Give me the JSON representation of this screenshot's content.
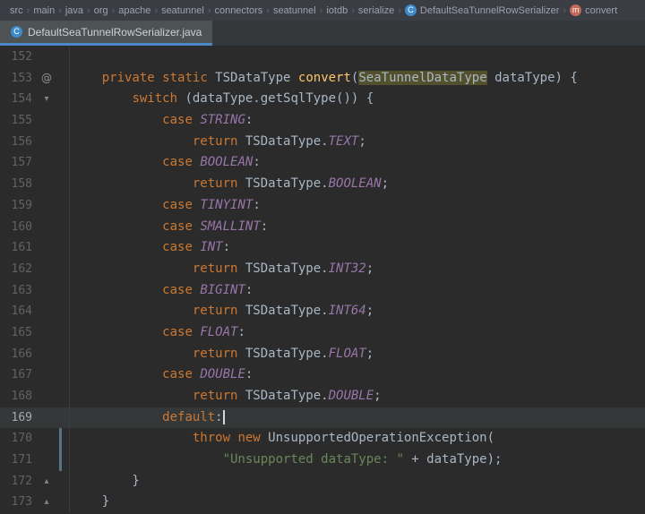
{
  "colors": {
    "editor_bg": "#2b2b2b",
    "navbar_bg": "#3a3d44",
    "tabbar_bg": "#35383a",
    "tab_bg": "#4d5355",
    "tab_underline": "#4a88c7",
    "caret_line_bg": "#343839",
    "gutter_text": "#606366",
    "keyword": "#cc7832",
    "plain": "#a9b7c6",
    "method_decl": "#ffc66b",
    "constant": "#9876aa",
    "string": "#6a8759",
    "identifier_highlight_bg": "#53502d",
    "vcs_changed": "#557387",
    "class_icon_bg": "#3f8ccb",
    "method_icon_bg": "#c4685a"
  },
  "icons": {
    "at": "@",
    "chevron_down": "▾",
    "chevron_up": "▴",
    "class_letter": "C",
    "method_letter": "m",
    "separator": "›"
  },
  "navbar": {
    "items": [
      {
        "label": "src"
      },
      {
        "label": "main"
      },
      {
        "label": "java"
      },
      {
        "label": "org"
      },
      {
        "label": "apache"
      },
      {
        "label": "seatunnel"
      },
      {
        "label": "connectors"
      },
      {
        "label": "seatunnel"
      },
      {
        "label": "iotdb"
      },
      {
        "label": "serialize"
      },
      {
        "label": "DefaultSeaTunnelRowSerializer",
        "icon": "class"
      },
      {
        "label": "convert",
        "icon": "method"
      }
    ]
  },
  "tabbar": {
    "tabs": [
      {
        "label": "DefaultSeaTunnelRowSerializer.java",
        "icon": "class",
        "active": true
      }
    ]
  },
  "editor": {
    "caret_line": "169",
    "lines": [
      {
        "num": "152",
        "tokens": []
      },
      {
        "num": "153",
        "gutter_icon": "at",
        "tokens": [
          [
            "pl",
            "    "
          ],
          [
            "kw",
            "private"
          ],
          [
            "pl",
            " "
          ],
          [
            "kw",
            "static"
          ],
          [
            "pl",
            " TSDataType "
          ],
          [
            "fn",
            "convert"
          ],
          [
            "pl",
            "("
          ],
          [
            "hl",
            "SeaTunnelDataType"
          ],
          [
            "pl",
            " dataType) {"
          ]
        ]
      },
      {
        "num": "154",
        "gutter_icon": "chevron_down",
        "tokens": [
          [
            "pl",
            "        "
          ],
          [
            "kw",
            "switch"
          ],
          [
            "pl",
            " (dataType.getSqlType()) {"
          ]
        ]
      },
      {
        "num": "155",
        "tokens": [
          [
            "pl",
            "            "
          ],
          [
            "kw",
            "case"
          ],
          [
            "pl",
            " "
          ],
          [
            "cn",
            "STRING"
          ],
          [
            "pl",
            ":"
          ]
        ]
      },
      {
        "num": "156",
        "tokens": [
          [
            "pl",
            "                "
          ],
          [
            "kw",
            "return"
          ],
          [
            "pl",
            " TSDataType."
          ],
          [
            "cn",
            "TEXT"
          ],
          [
            "pl",
            ";"
          ]
        ]
      },
      {
        "num": "157",
        "tokens": [
          [
            "pl",
            "            "
          ],
          [
            "kw",
            "case"
          ],
          [
            "pl",
            " "
          ],
          [
            "cn",
            "BOOLEAN"
          ],
          [
            "pl",
            ":"
          ]
        ]
      },
      {
        "num": "158",
        "tokens": [
          [
            "pl",
            "                "
          ],
          [
            "kw",
            "return"
          ],
          [
            "pl",
            " TSDataType."
          ],
          [
            "cn",
            "BOOLEAN"
          ],
          [
            "pl",
            ";"
          ]
        ]
      },
      {
        "num": "159",
        "tokens": [
          [
            "pl",
            "            "
          ],
          [
            "kw",
            "case"
          ],
          [
            "pl",
            " "
          ],
          [
            "cn",
            "TINYINT"
          ],
          [
            "pl",
            ":"
          ]
        ]
      },
      {
        "num": "160",
        "tokens": [
          [
            "pl",
            "            "
          ],
          [
            "kw",
            "case"
          ],
          [
            "pl",
            " "
          ],
          [
            "cn",
            "SMALLINT"
          ],
          [
            "pl",
            ":"
          ]
        ]
      },
      {
        "num": "161",
        "tokens": [
          [
            "pl",
            "            "
          ],
          [
            "kw",
            "case"
          ],
          [
            "pl",
            " "
          ],
          [
            "cn",
            "INT"
          ],
          [
            "pl",
            ":"
          ]
        ]
      },
      {
        "num": "162",
        "tokens": [
          [
            "pl",
            "                "
          ],
          [
            "kw",
            "return"
          ],
          [
            "pl",
            " TSDataType."
          ],
          [
            "cn",
            "INT32"
          ],
          [
            "pl",
            ";"
          ]
        ]
      },
      {
        "num": "163",
        "tokens": [
          [
            "pl",
            "            "
          ],
          [
            "kw",
            "case"
          ],
          [
            "pl",
            " "
          ],
          [
            "cn",
            "BIGINT"
          ],
          [
            "pl",
            ":"
          ]
        ]
      },
      {
        "num": "164",
        "tokens": [
          [
            "pl",
            "                "
          ],
          [
            "kw",
            "return"
          ],
          [
            "pl",
            " TSDataType."
          ],
          [
            "cn",
            "INT64"
          ],
          [
            "pl",
            ";"
          ]
        ]
      },
      {
        "num": "165",
        "tokens": [
          [
            "pl",
            "            "
          ],
          [
            "kw",
            "case"
          ],
          [
            "pl",
            " "
          ],
          [
            "cn",
            "FLOAT"
          ],
          [
            "pl",
            ":"
          ]
        ]
      },
      {
        "num": "166",
        "tokens": [
          [
            "pl",
            "                "
          ],
          [
            "kw",
            "return"
          ],
          [
            "pl",
            " TSDataType."
          ],
          [
            "cn",
            "FLOAT"
          ],
          [
            "pl",
            ";"
          ]
        ]
      },
      {
        "num": "167",
        "tokens": [
          [
            "pl",
            "            "
          ],
          [
            "kw",
            "case"
          ],
          [
            "pl",
            " "
          ],
          [
            "cn",
            "DOUBLE"
          ],
          [
            "pl",
            ":"
          ]
        ]
      },
      {
        "num": "168",
        "tokens": [
          [
            "pl",
            "                "
          ],
          [
            "kw",
            "return"
          ],
          [
            "pl",
            " TSDataType."
          ],
          [
            "cn",
            "DOUBLE"
          ],
          [
            "pl",
            ";"
          ]
        ]
      },
      {
        "num": "169",
        "caret": true,
        "tokens": [
          [
            "pl",
            "            "
          ],
          [
            "kw",
            "default"
          ],
          [
            "pl",
            ":"
          ]
        ]
      },
      {
        "num": "170",
        "vcs": true,
        "tokens": [
          [
            "pl",
            "                "
          ],
          [
            "kw",
            "throw"
          ],
          [
            "pl",
            " "
          ],
          [
            "kw",
            "new"
          ],
          [
            "pl",
            " UnsupportedOperationException("
          ]
        ]
      },
      {
        "num": "171",
        "vcs": true,
        "tokens": [
          [
            "pl",
            "                    "
          ],
          [
            "str",
            "\"Unsupported dataType: \""
          ],
          [
            "pl",
            " + dataType);"
          ]
        ]
      },
      {
        "num": "172",
        "gutter_icon": "chevron_up",
        "tokens": [
          [
            "pl",
            "        }"
          ]
        ]
      },
      {
        "num": "173",
        "gutter_icon": "chevron_up",
        "tokens": [
          [
            "pl",
            "    }"
          ]
        ]
      }
    ]
  }
}
